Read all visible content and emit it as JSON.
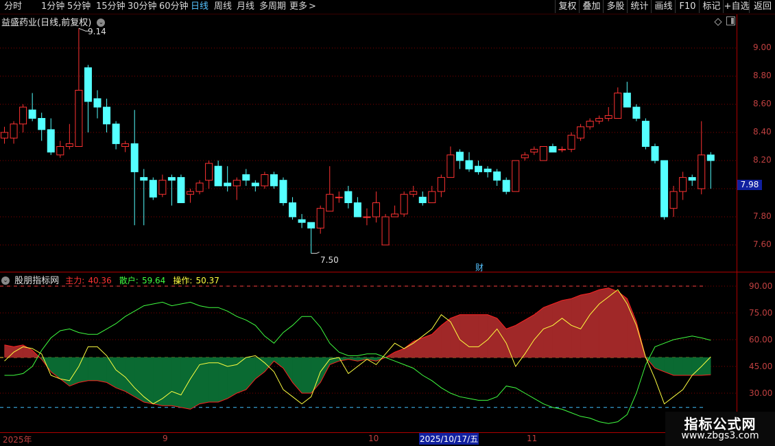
{
  "toolbar": {
    "periods": [
      "分时",
      "1分钟",
      "5分钟",
      "15分钟",
      "30分钟",
      "60分钟",
      "日线",
      "周线",
      "月线",
      "多周期",
      "更多"
    ],
    "active_period": "日线",
    "more_arrow": ">",
    "tools": [
      "复权",
      "叠加",
      "多股",
      "统计",
      "画线",
      "F10",
      "标记",
      "+自选",
      "返回"
    ]
  },
  "main_chart": {
    "title": "益盛药业(日线,前复权)",
    "y_ticks": [
      "9.00",
      "8.80",
      "8.60",
      "8.40",
      "8.20",
      "7.80",
      "7.60"
    ],
    "high_label": "9.14",
    "low_label": "7.50",
    "current_price": "7.98",
    "event_marker": "财"
  },
  "indicator": {
    "name": "股朋指标网",
    "main_force_label": "主力:",
    "main_force_value": "40.36",
    "retail_label": "散户:",
    "retail_value": "59.64",
    "operate_label": "操作:",
    "operate_value": "50.37",
    "y_ticks": [
      "90.00",
      "75.00",
      "60.00",
      "45.00",
      "30.00"
    ]
  },
  "time_axis": {
    "labels": [
      "2025年",
      "9",
      "10",
      "2025/10/17/五",
      "11"
    ]
  },
  "watermark": {
    "line1": "指标公式网",
    "line2": "www.zbgs3.com"
  },
  "colors": {
    "up": "#ff3232",
    "down": "#54ffff",
    "grid": "#8a0000",
    "axis_text": "#c04040",
    "fill_red": "#a02828",
    "fill_green": "#0a6a32",
    "line_yellow": "#ffff40",
    "line_green": "#40ff40",
    "active_tab": "#56c3ff"
  },
  "chart_data": {
    "type": "candlestick",
    "price_axis": {
      "ylim": [
        7.44,
        9.3
      ]
    },
    "candles": [
      [
        8.36,
        8.4,
        8.32,
        8.44
      ],
      [
        8.36,
        8.46,
        8.32,
        8.48
      ],
      [
        8.46,
        8.58,
        8.4,
        8.6
      ],
      [
        8.56,
        8.5,
        8.48,
        8.68
      ],
      [
        8.5,
        8.42,
        8.34,
        8.54
      ],
      [
        8.42,
        8.26,
        8.24,
        8.5
      ],
      [
        8.24,
        8.3,
        8.22,
        8.34
      ],
      [
        8.3,
        8.32,
        8.28,
        8.46
      ],
      [
        8.3,
        8.7,
        8.3,
        9.14
      ],
      [
        8.86,
        8.62,
        8.4,
        8.88
      ],
      [
        8.64,
        8.58,
        8.5,
        8.7
      ],
      [
        8.58,
        8.46,
        8.4,
        8.64
      ],
      [
        8.46,
        8.32,
        8.28,
        8.48
      ],
      [
        8.3,
        8.32,
        8.26,
        8.34
      ],
      [
        8.32,
        8.12,
        7.74,
        8.56
      ],
      [
        8.08,
        8.06,
        7.74,
        8.14
      ],
      [
        8.06,
        7.94,
        7.92,
        8.08
      ],
      [
        7.96,
        8.06,
        7.94,
        8.1
      ],
      [
        8.08,
        8.06,
        7.88,
        8.1
      ],
      [
        8.08,
        7.9,
        7.9,
        8.1
      ],
      [
        7.96,
        7.98,
        7.9,
        8.0
      ],
      [
        7.98,
        8.04,
        7.96,
        8.06
      ],
      [
        8.06,
        8.18,
        8.0,
        8.2
      ],
      [
        8.16,
        8.02,
        8.02,
        8.2
      ],
      [
        8.04,
        8.02,
        7.98,
        8.16
      ],
      [
        8.02,
        8.06,
        7.92,
        8.08
      ],
      [
        8.1,
        8.06,
        8.02,
        8.14
      ],
      [
        8.04,
        8.02,
        7.98,
        8.06
      ],
      [
        8.02,
        8.1,
        8.0,
        8.12
      ],
      [
        8.1,
        8.02,
        8.0,
        8.12
      ],
      [
        8.06,
        7.9,
        7.88,
        8.08
      ],
      [
        7.9,
        7.8,
        7.78,
        7.94
      ],
      [
        7.78,
        7.76,
        7.72,
        7.82
      ],
      [
        7.76,
        7.72,
        7.54,
        7.76
      ],
      [
        7.72,
        7.86,
        7.68,
        7.88
      ],
      [
        7.84,
        7.96,
        7.84,
        8.16
      ],
      [
        7.94,
        7.94,
        7.9,
        7.98
      ],
      [
        7.98,
        7.9,
        7.86,
        8.02
      ],
      [
        7.9,
        7.8,
        7.8,
        7.94
      ],
      [
        7.8,
        7.8,
        7.74,
        7.86
      ],
      [
        7.8,
        7.9,
        7.76,
        7.98
      ],
      [
        7.6,
        7.8,
        7.6,
        7.82
      ],
      [
        7.8,
        7.82,
        7.8,
        7.88
      ],
      [
        7.82,
        7.96,
        7.8,
        7.98
      ],
      [
        7.96,
        7.98,
        7.94,
        8.02
      ],
      [
        7.94,
        7.9,
        7.88,
        7.98
      ],
      [
        7.9,
        7.98,
        7.9,
        8.02
      ],
      [
        7.98,
        8.08,
        7.94,
        8.1
      ],
      [
        8.08,
        8.24,
        8.08,
        8.3
      ],
      [
        8.26,
        8.2,
        8.14,
        8.28
      ],
      [
        8.2,
        8.14,
        8.12,
        8.26
      ],
      [
        8.16,
        8.12,
        8.1,
        8.2
      ],
      [
        8.14,
        8.12,
        8.08,
        8.16
      ],
      [
        8.12,
        8.06,
        8.02,
        8.14
      ],
      [
        8.06,
        7.98,
        7.96,
        8.08
      ],
      [
        7.98,
        8.2,
        7.98,
        8.2
      ],
      [
        8.22,
        8.24,
        8.2,
        8.26
      ],
      [
        8.26,
        8.28,
        8.24,
        8.3
      ],
      [
        8.2,
        8.3,
        8.2,
        8.3
      ],
      [
        8.3,
        8.26,
        8.26,
        8.32
      ],
      [
        8.28,
        8.28,
        8.26,
        8.3
      ],
      [
        8.28,
        8.38,
        8.26,
        8.4
      ],
      [
        8.36,
        8.44,
        8.34,
        8.46
      ],
      [
        8.44,
        8.48,
        8.42,
        8.5
      ],
      [
        8.48,
        8.5,
        8.46,
        8.52
      ],
      [
        8.5,
        8.52,
        8.48,
        8.58
      ],
      [
        8.5,
        8.68,
        8.5,
        8.72
      ],
      [
        8.68,
        8.58,
        8.58,
        8.76
      ],
      [
        8.58,
        8.5,
        8.48,
        8.6
      ],
      [
        8.48,
        8.3,
        8.28,
        8.5
      ],
      [
        8.3,
        8.2,
        8.18,
        8.32
      ],
      [
        8.2,
        7.8,
        7.78,
        8.2
      ],
      [
        7.86,
        7.98,
        7.8,
        8.02
      ],
      [
        7.98,
        8.08,
        7.92,
        8.12
      ],
      [
        8.08,
        8.06,
        8.02,
        8.1
      ],
      [
        8.0,
        8.24,
        7.96,
        8.48
      ],
      [
        8.24,
        8.2,
        8.0,
        8.26
      ]
    ],
    "indicator_axis": {
      "ylim": [
        20.5,
        92.5
      ]
    },
    "series": [
      {
        "name": "主力",
        "values": [
          57,
          56,
          57,
          54,
          49,
          42,
          38,
          34,
          36,
          37,
          37,
          36,
          33,
          31,
          28,
          25,
          24,
          23,
          23,
          22,
          21,
          24,
          25,
          25,
          27,
          30,
          32,
          38,
          42,
          48,
          44,
          36,
          30,
          30,
          36,
          46,
          48,
          49,
          48,
          49,
          48,
          50,
          53,
          55,
          59,
          61,
          63,
          68,
          72,
          74,
          74,
          74,
          74,
          72,
          66,
          68,
          71,
          74,
          78,
          80,
          82,
          83,
          85,
          86,
          88,
          89,
          87,
          83,
          70,
          50,
          44,
          42,
          40,
          40,
          40,
          40,
          40.36
        ]
      },
      {
        "name": "散户",
        "values": [
          40,
          40,
          41,
          45,
          54,
          61,
          65,
          66,
          64,
          63,
          63,
          66,
          69,
          73,
          76,
          79,
          80,
          81,
          79,
          80,
          81,
          79,
          78,
          78,
          76,
          73,
          71,
          68,
          62,
          58,
          64,
          68,
          73,
          73,
          67,
          58,
          53,
          51,
          51,
          52,
          52,
          50,
          48,
          46,
          44,
          40,
          37,
          33,
          30,
          28,
          27,
          26,
          26,
          28,
          34,
          33,
          30,
          27,
          24,
          22,
          21,
          19,
          17,
          16,
          14,
          13,
          14,
          18,
          30,
          46,
          56,
          58,
          60,
          61,
          62,
          61,
          59.64
        ]
      },
      {
        "name": "操作",
        "values": [
          48,
          53,
          56,
          55,
          52,
          40,
          38,
          37,
          45,
          56,
          56,
          51,
          43,
          39,
          33,
          28,
          24,
          27,
          31,
          29,
          38,
          46,
          47,
          47,
          45,
          46,
          50,
          51,
          47,
          42,
          32,
          28,
          24,
          28,
          42,
          49,
          50,
          41,
          45,
          49,
          46,
          52,
          58,
          55,
          58,
          62,
          66,
          74,
          70,
          60,
          56,
          56,
          60,
          66,
          58,
          45,
          52,
          60,
          66,
          68,
          72,
          68,
          66,
          74,
          80,
          84,
          88,
          80,
          68,
          50,
          38,
          24,
          28,
          32,
          40,
          45,
          50.37
        ]
      }
    ],
    "title": "",
    "xlabel": "",
    "ylabel": ""
  }
}
